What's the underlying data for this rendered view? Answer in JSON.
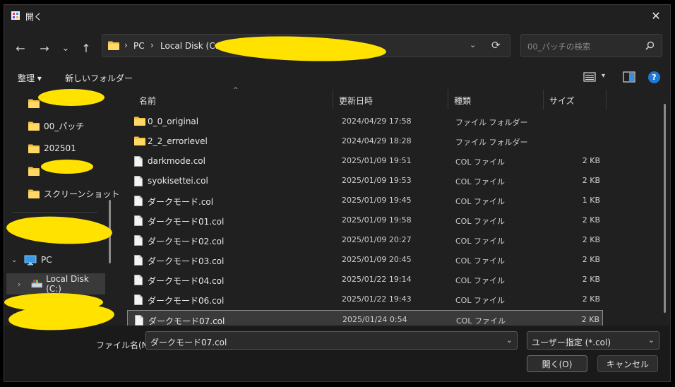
{
  "window": {
    "title": "開く",
    "close_glyph": "✕"
  },
  "nav": {
    "back": "←",
    "forward": "→",
    "recent": "⌄",
    "up": "↑"
  },
  "address": {
    "crumbs": [
      "PC",
      "Local Disk (C:)"
    ],
    "separator": "›",
    "dropdown": "⌄",
    "refresh": "⟳"
  },
  "search": {
    "placeholder": "00_パッチの検索"
  },
  "toolbar": {
    "organize": "整理 ▾",
    "new_folder": "新しいフォルダー",
    "view_caret": "▾",
    "help": "?"
  },
  "sidebar": {
    "items": [
      "",
      "00_パッチ",
      "202501",
      "",
      "スクリーンショット"
    ],
    "pc": "PC",
    "disk": "Local Disk (C:)"
  },
  "columns": {
    "name": "名前",
    "date": "更新日時",
    "type": "種類",
    "size": "サイズ",
    "sort": "^"
  },
  "files": [
    {
      "name": "0_0_original",
      "date": "2024/04/29 17:58",
      "type": "ファイル フォルダー",
      "size": "",
      "kind": "folder"
    },
    {
      "name": "2_2_errorlevel",
      "date": "2024/04/29 18:28",
      "type": "ファイル フォルダー",
      "size": "",
      "kind": "folder"
    },
    {
      "name": "darkmode.col",
      "date": "2025/01/09 19:51",
      "type": "COL ファイル",
      "size": "2 KB",
      "kind": "file"
    },
    {
      "name": "syokisettei.col",
      "date": "2025/01/09 19:53",
      "type": "COL ファイル",
      "size": "2 KB",
      "kind": "file"
    },
    {
      "name": "ダークモード.col",
      "date": "2025/01/09 19:45",
      "type": "COL ファイル",
      "size": "1 KB",
      "kind": "file"
    },
    {
      "name": "ダークモード01.col",
      "date": "2025/01/09 19:58",
      "type": "COL ファイル",
      "size": "2 KB",
      "kind": "file"
    },
    {
      "name": "ダークモード02.col",
      "date": "2025/01/09 20:27",
      "type": "COL ファイル",
      "size": "2 KB",
      "kind": "file"
    },
    {
      "name": "ダークモード03.col",
      "date": "2025/01/09 20:45",
      "type": "COL ファイル",
      "size": "2 KB",
      "kind": "file"
    },
    {
      "name": "ダークモード04.col",
      "date": "2025/01/22 19:14",
      "type": "COL ファイル",
      "size": "2 KB",
      "kind": "file"
    },
    {
      "name": "ダークモード06.col",
      "date": "2025/01/22 19:43",
      "type": "COL ファイル",
      "size": "2 KB",
      "kind": "file"
    },
    {
      "name": "ダークモード07.col",
      "date": "2025/01/24 0:54",
      "type": "COL ファイル",
      "size": "2 KB",
      "kind": "file",
      "selected": true
    }
  ],
  "bottom": {
    "filename_label": "ファイル名(N):",
    "filename_value": "ダークモード07.col",
    "filetype_value": "ユーザー指定 (*.col)",
    "dropdown": "⌄",
    "open": "開く(O)",
    "cancel": "キャンセル"
  },
  "colors": {
    "background": "#202020",
    "accent": "#1e78d6",
    "folder": "#f5c242",
    "redaction": "#ffe200"
  }
}
